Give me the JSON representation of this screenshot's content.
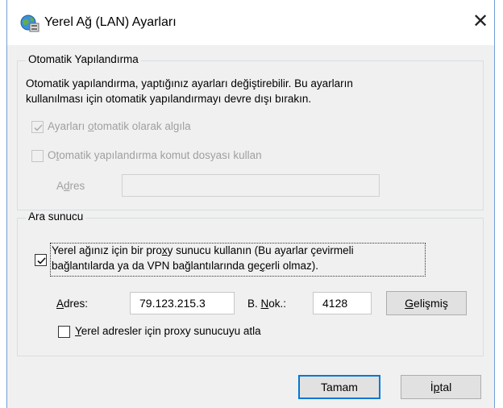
{
  "window": {
    "title": "Yerel Ağ (LAN) Ayarları",
    "close_glyph": "✕"
  },
  "auto_config": {
    "legend": "Otomatik Yapılandırma",
    "description_line1": "Otomatik yapılandırma, yaptığınız ayarları değiştirebilir. Bu ayarların",
    "description_line2": "kullanılması için otomatik yapılandırmayı devre dışı bırakın.",
    "auto_detect": {
      "label_pre": "Ayarları ",
      "label_u": "o",
      "label_post": "tomatik olarak algıla",
      "checked": true,
      "enabled": false
    },
    "use_script": {
      "label_pre": "O",
      "label_u": "t",
      "label_post": "omatik yapılandırma komut dosyası kullan",
      "checked": false,
      "enabled": false
    },
    "address": {
      "label_pre": "A",
      "label_u": "d",
      "label_post": "res",
      "value": ""
    }
  },
  "proxy": {
    "legend": "Ara sunucu",
    "use_proxy": {
      "line1_pre": "Y",
      "line1_u_first": "erel ağınız için bir pro",
      "line1_u": "x",
      "line1_post": "y sunucu kullanın (Bu ayarlar çevirmeli",
      "line2_pre": "bağlantılarda ya da VPN bağlantılarında ge",
      "line2_u": "ç",
      "line2_post": "erli olmaz).",
      "checked": true
    },
    "address": {
      "label_u": "A",
      "label_post": "dres:",
      "value": "79.123.215.3"
    },
    "port": {
      "label_pre": "B. ",
      "label_u": "N",
      "label_post": "ok.:",
      "value": "4128"
    },
    "advanced_button": {
      "label_u": "G",
      "label_post": "elişmiş"
    },
    "bypass_local": {
      "label_u": "Y",
      "label_post": "erel adresler için proxy sunucuyu atla",
      "checked": false
    }
  },
  "buttons": {
    "ok": "Tamam",
    "cancel": {
      "label_pre": "İ",
      "label_u": "p",
      "label_post": "tal"
    }
  },
  "colors": {
    "accent": "#0078d7",
    "window_bg": "#f0f0f0",
    "disabled_text": "#a0a0a0"
  }
}
